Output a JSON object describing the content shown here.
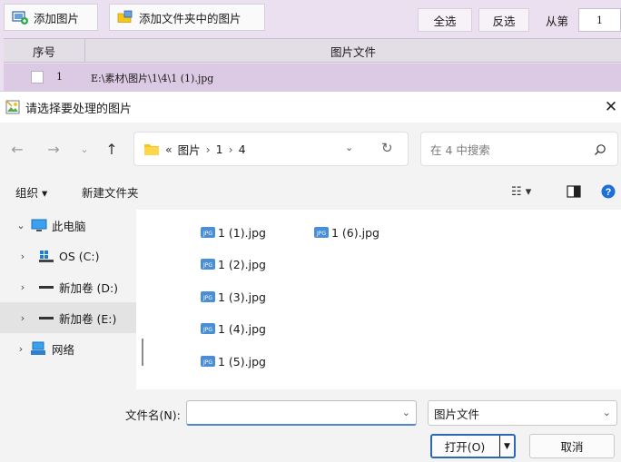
{
  "app": {
    "toolbar": {
      "add_image": "添加图片",
      "add_folder_images": "添加文件夹中的图片",
      "select_all": "全选",
      "invert_select": "反选",
      "from_page_label": "从第",
      "from_page_value": "1"
    },
    "table": {
      "headers": [
        "序号",
        "图片文件"
      ],
      "rows": [
        {
          "index": "1",
          "file": "E:\\素材\\图片\\1\\4\\1 (1).jpg"
        }
      ]
    }
  },
  "dialog": {
    "title": "请选择要处理的图片",
    "address": {
      "overflow": "«",
      "crumbs": [
        "图片",
        "1",
        "4"
      ]
    },
    "search_placeholder": "在 4 中搜索",
    "cmd": {
      "organize": "组织 ▾",
      "new_folder": "新建文件夹"
    },
    "tree": [
      {
        "label": "此电脑",
        "icon": "monitor-icon",
        "expanded": true
      },
      {
        "label": "OS (C:)",
        "icon": "windows-drive-icon"
      },
      {
        "label": "新加卷 (D:)",
        "icon": "drive-icon"
      },
      {
        "label": "新加卷 (E:)",
        "icon": "drive-icon",
        "selected": true
      },
      {
        "label": "网络",
        "icon": "network-icon"
      }
    ],
    "files": [
      "1 (1).jpg",
      "1 (2).jpg",
      "1 (3).jpg",
      "1 (4).jpg",
      "1 (5).jpg",
      "1 (6).jpg"
    ],
    "filename_label": "文件名(N):",
    "filename_value": "",
    "file_type": "图片文件",
    "open_label": "打开(O)",
    "cancel_label": "取消"
  },
  "colors": {
    "app_bg": "#ebe0ef",
    "row_selected": "#dcc9e3",
    "accent": "#2b69b5",
    "help": "#1e6fd9",
    "folder": "#f5c518"
  }
}
